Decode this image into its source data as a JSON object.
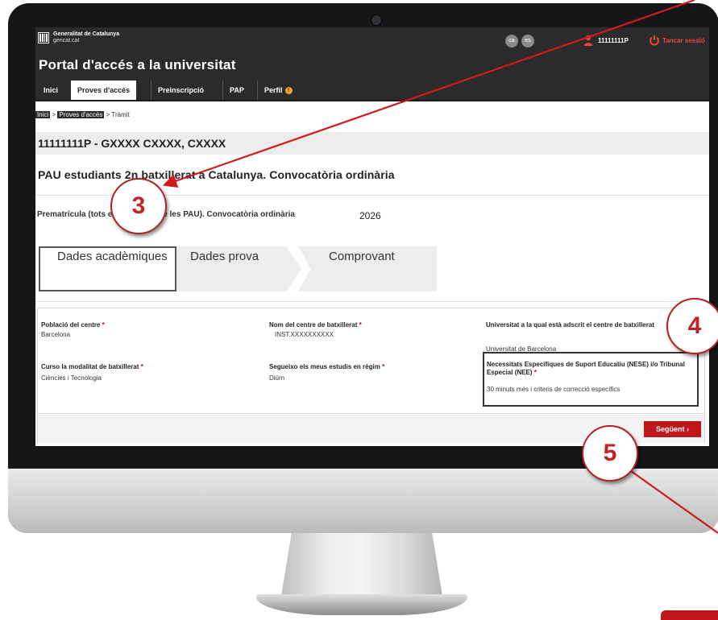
{
  "header": {
    "org_name": "Generalitat de Catalunya",
    "org_site": "gencat.cat",
    "lang_ca": "ca",
    "lang_es": "es",
    "user_id": "11111111P",
    "logout_label": "Tancar sessió",
    "portal_title": "Portal d'accés a la universitat"
  },
  "nav": {
    "items": [
      "Inici",
      "Proves d'accés",
      "Preinscripció",
      "PAP",
      "Perfil"
    ],
    "active": "Proves d'accés"
  },
  "breadcrumb": {
    "home": "Inici",
    "section": "Proves d'accés",
    "current": "Tràmit",
    "separator": ">"
  },
  "student": {
    "id_line": "11111111P - GXXXX CXXXX, CXXXX"
  },
  "convocatoria_title": "PAU estudiants 2n batxillerat a Catalunya. Convocatòria ordinària",
  "prematricula": {
    "text": "Prematrícula (tots els exàmens de les PAU). Convocatòria ordinària",
    "year": "2026"
  },
  "steps": [
    {
      "label": "Dades acadèmiques",
      "state": "active"
    },
    {
      "label": "Dades prova",
      "state": "inactive"
    },
    {
      "label": "Comprovant",
      "state": "inactive"
    }
  ],
  "form": {
    "poblacio": {
      "label": "Població del centre",
      "value": "Barcelona"
    },
    "nom_centre": {
      "label": "Nom del centre de batxillerat",
      "value": "INST.XXXXXXXXXX"
    },
    "universitat": {
      "label": "Universitat a la qual està adscrit el centre de batxillerat",
      "value": "Universitat de Barcelona"
    },
    "modalitat": {
      "label": "Curso la modalitat de batxillerat",
      "value": "Ciències i Tecnologia"
    },
    "regim": {
      "label": "Segueixo els meus estudis en règim",
      "value": "Diürn"
    },
    "nese": {
      "label": "Necessitats Específiques de Suport Educatiu (NESE) i/o Tribunal Especial (NEE)",
      "value": "30 minuts més i criteris de correcció específics"
    },
    "required_mark": "*",
    "next_label": "Següent"
  },
  "annotations": [
    "3",
    "4",
    "5"
  ],
  "colors": {
    "header_bg": "#2b2b2b",
    "accent_red": "#c0151b",
    "badge_border": "#b42025",
    "arrow_red": "#d11a1a"
  }
}
